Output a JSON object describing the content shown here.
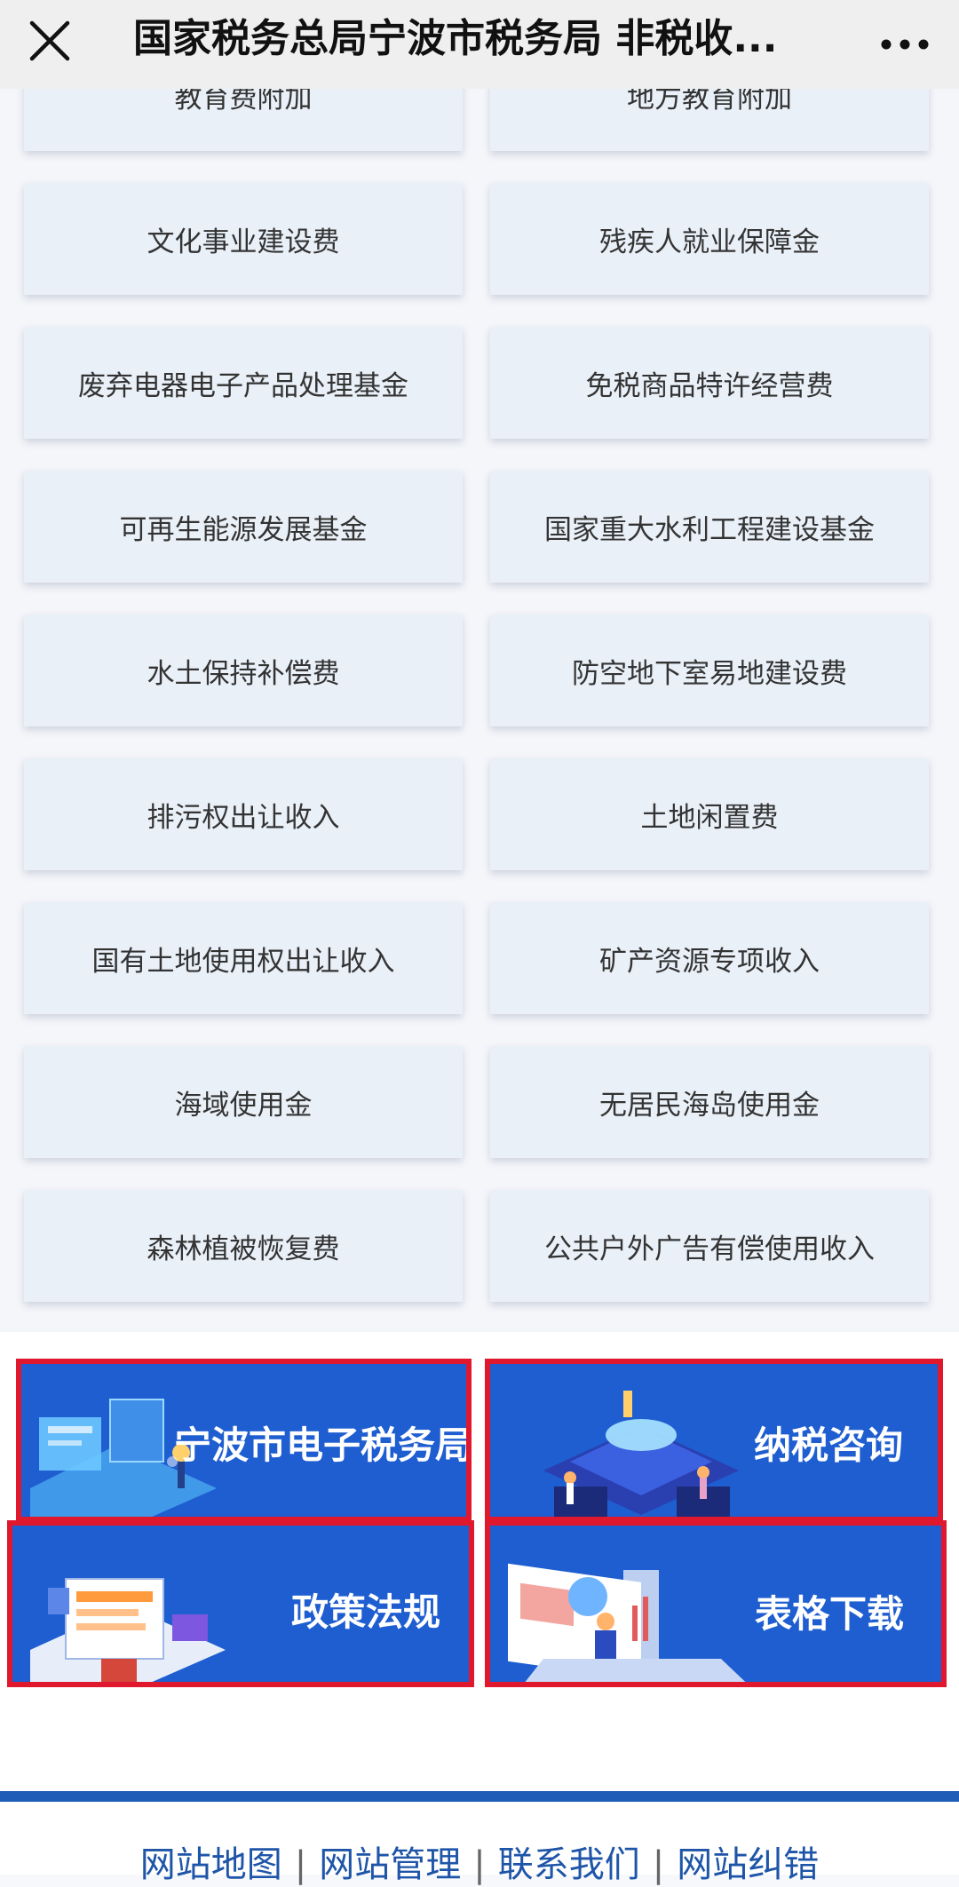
{
  "header": {
    "title": "国家税务总局宁波市税务局 非税收...",
    "close_icon": "close-icon",
    "more_icon": "more-icon"
  },
  "items": [
    [
      "教育费附加",
      "地方教育附加"
    ],
    [
      "文化事业建设费",
      "残疾人就业保障金"
    ],
    [
      "废弃电器电子产品处理基金",
      "免税商品特许经营费"
    ],
    [
      "可再生能源发展基金",
      "国家重大水利工程建设基金"
    ],
    [
      "水土保持补偿费",
      "防空地下室易地建设费"
    ],
    [
      "排污权出让收入",
      "土地闲置费"
    ],
    [
      "国有土地使用权出让收入",
      "矿产资源专项收入"
    ],
    [
      "海域使用金",
      "无居民海岛使用金"
    ],
    [
      "森林植被恢复费",
      "公共户外广告有偿使用收入"
    ]
  ],
  "banners": {
    "etax": "宁波市电子税务局",
    "consult": "纳税咨询",
    "policy": "政策法规",
    "forms": "表格下载"
  },
  "footer": {
    "sitemap": "网站地图",
    "admin": "网站管理",
    "contact": "联系我们",
    "errata": "网站纠错",
    "separator": "|"
  },
  "colors": {
    "banner_blue": "#1e5ed0",
    "highlight_red": "#e0182d",
    "footer_blue": "#1e5cb8"
  }
}
